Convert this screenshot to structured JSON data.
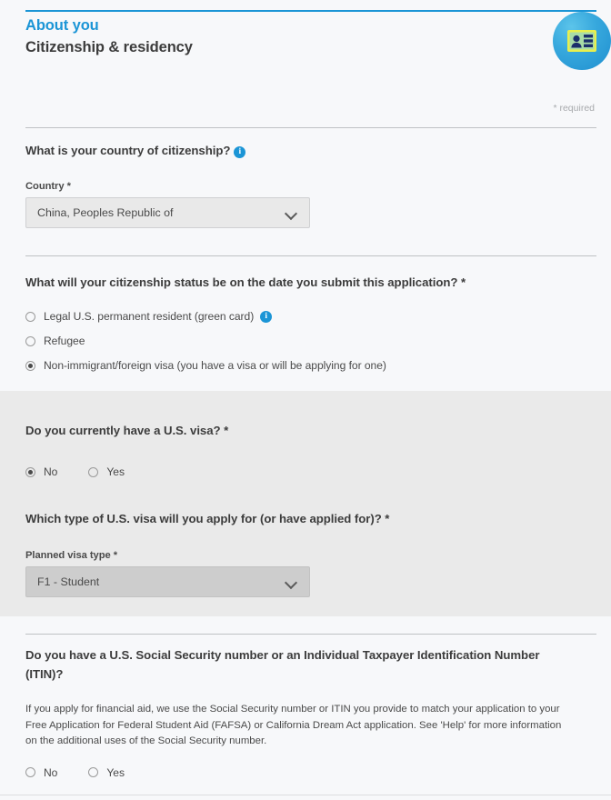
{
  "header": {
    "eyebrow": "About you",
    "title": "Citizenship & residency",
    "badge_icon": "id-card-icon",
    "required_note": "* required",
    "accent_color": "#1b95d6"
  },
  "sections": {
    "citizenship_country": {
      "question": "What is your country of citizenship?",
      "info_icon": "info-icon",
      "info_glyph": "i",
      "field_label": "Country *",
      "selected_value": "China, Peoples Republic of",
      "chevron_icon": "chevron-down-icon"
    },
    "citizenship_status": {
      "question": "What will your citizenship status be on the date you submit this application? *",
      "options": [
        {
          "label": "Legal U.S. permanent resident (green card)",
          "checked": false,
          "has_info": true
        },
        {
          "label": "Refugee",
          "checked": false,
          "has_info": false
        },
        {
          "label": "Non-immigrant/foreign visa (you have a visa or will be applying for one)",
          "checked": true,
          "has_info": false
        }
      ],
      "info_glyph": "i"
    },
    "current_visa": {
      "question": "Do you currently have a U.S. visa? *",
      "options": [
        {
          "label": "No",
          "checked": true
        },
        {
          "label": "Yes",
          "checked": false
        }
      ]
    },
    "visa_type": {
      "question": "Which type of U.S. visa will you apply for (or have applied for)? *",
      "field_label": "Planned visa type *",
      "selected_value": "F1 - Student",
      "chevron_icon": "chevron-down-icon"
    },
    "ssn": {
      "question_line1": "Do you have a U.S. Social Security number or an Individual Taxpayer Identification Number",
      "question_line2": "(ITIN)?",
      "help_text": "If you apply for financial aid, we use the Social Security number or ITIN you provide to match your application to your Free Application for Federal Student Aid (FAFSA) or California Dream Act application. See 'Help' for more information on the additional uses of the Social Security number.",
      "options": [
        {
          "label": "No",
          "checked": false
        },
        {
          "label": "Yes",
          "checked": false
        }
      ]
    }
  }
}
